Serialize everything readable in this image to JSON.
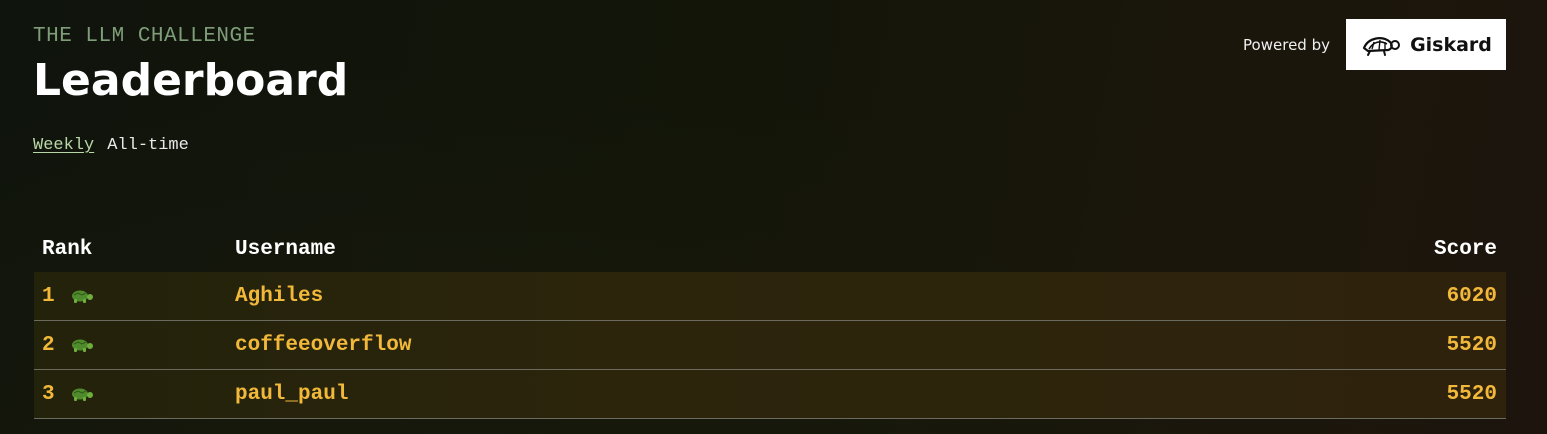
{
  "header": {
    "eyebrow": "THE LLM CHALLENGE",
    "title": "Leaderboard"
  },
  "tabs": [
    {
      "label": "Weekly",
      "active": true
    },
    {
      "label": "All-time",
      "active": false
    }
  ],
  "powered_by": {
    "label": "Powered by",
    "logo_text": "Giskard",
    "logo_icon": "turtle-icon"
  },
  "table": {
    "headers": {
      "rank": "Rank",
      "username": "Username",
      "score": "Score"
    },
    "rows": [
      {
        "rank": "1",
        "icon": "turtle-icon",
        "username": "Aghiles",
        "score": "6020"
      },
      {
        "rank": "2",
        "icon": "turtle-icon",
        "username": "coffeeoverflow",
        "score": "5520"
      },
      {
        "rank": "3",
        "icon": "turtle-icon",
        "username": "paul_paul",
        "score": "5520"
      }
    ]
  },
  "colors": {
    "background": "#131509",
    "eyebrow": "#7f9d78",
    "active_tab": "#b9d6a9",
    "row_text": "#f2b83a",
    "turtle": "#4f8a2c"
  }
}
